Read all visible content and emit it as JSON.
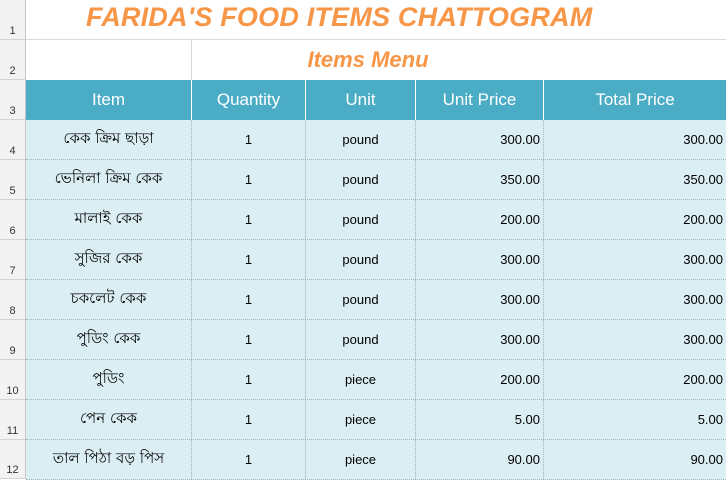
{
  "sheet": {
    "title": "FARIDA'S FOOD ITEMS CHATTOGRAM",
    "subtitle": "Items  Menu",
    "row_numbers": [
      "1",
      "2",
      "3",
      "4",
      "5",
      "6",
      "7",
      "8",
      "9",
      "10",
      "11",
      "12"
    ],
    "columns": [
      "Item",
      "Quantity",
      "Unit",
      "Unit Price",
      "Total Price"
    ],
    "rows": [
      {
        "item": "কেক ক্রিম ছাড়া",
        "qty": "1",
        "unit": "pound",
        "unit_price": "300.00",
        "total": "300.00"
      },
      {
        "item": "ভেনিলা ক্রিম কেক",
        "qty": "1",
        "unit": "pound",
        "unit_price": "350.00",
        "total": "350.00"
      },
      {
        "item": "মালাই কেক",
        "qty": "1",
        "unit": "pound",
        "unit_price": "200.00",
        "total": "200.00"
      },
      {
        "item": "সুজির কেক",
        "qty": "1",
        "unit": "pound",
        "unit_price": "300.00",
        "total": "300.00"
      },
      {
        "item": "চকলেট কেক",
        "qty": "1",
        "unit": "pound",
        "unit_price": "300.00",
        "total": "300.00"
      },
      {
        "item": "পুডিং কেক",
        "qty": "1",
        "unit": "pound",
        "unit_price": "300.00",
        "total": "300.00"
      },
      {
        "item": "পুডিং",
        "qty": "1",
        "unit": "piece",
        "unit_price": "200.00",
        "total": "200.00"
      },
      {
        "item": "পেন কেক",
        "qty": "1",
        "unit": "piece",
        "unit_price": "5.00",
        "total": "5.00"
      },
      {
        "item": "তাল পিঠা বড় পিস",
        "qty": "1",
        "unit": "piece",
        "unit_price": "90.00",
        "total": "90.00"
      }
    ]
  },
  "colors": {
    "title": "#f79646",
    "header_bg": "#4bacc6",
    "row_bg": "#daeef3"
  }
}
